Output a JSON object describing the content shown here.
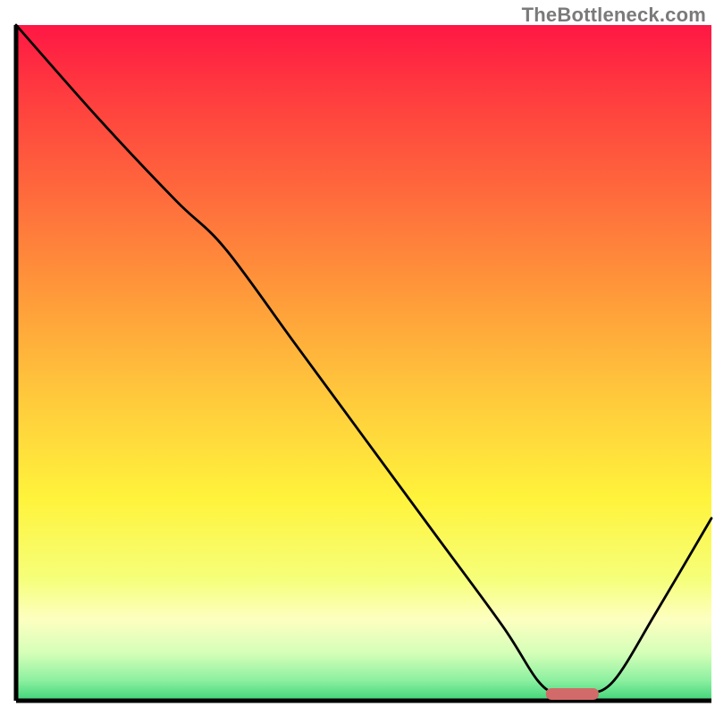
{
  "watermark": "TheBottleneck.com",
  "chart_data": {
    "type": "line",
    "title": "",
    "xlabel": "",
    "ylabel": "",
    "xlim": [
      0,
      100
    ],
    "ylim": [
      0,
      100
    ],
    "grid": false,
    "legend": false,
    "series": [
      {
        "name": "bottleneck-curve",
        "x": [
          0,
          12,
          23,
          30,
          40,
          50,
          60,
          70,
          75,
          78,
          82,
          86,
          92,
          100
        ],
        "y": [
          100,
          86,
          74,
          67,
          53,
          39,
          25,
          11,
          3,
          1,
          1,
          3,
          13,
          27
        ]
      }
    ],
    "marker": {
      "name": "optimal-range",
      "x_center": 80,
      "x_half_width": 3.8,
      "y": 1,
      "color": "#d36a6a"
    },
    "background_gradient": {
      "type": "vertical",
      "stops": [
        {
          "offset": 0.0,
          "color": "#ff1744"
        },
        {
          "offset": 0.1,
          "color": "#ff3b3f"
        },
        {
          "offset": 0.25,
          "color": "#ff6a3c"
        },
        {
          "offset": 0.4,
          "color": "#ff9a3a"
        },
        {
          "offset": 0.55,
          "color": "#ffc93c"
        },
        {
          "offset": 0.7,
          "color": "#fff33b"
        },
        {
          "offset": 0.82,
          "color": "#f6ff7a"
        },
        {
          "offset": 0.88,
          "color": "#fdffc0"
        },
        {
          "offset": 0.93,
          "color": "#d4ffb8"
        },
        {
          "offset": 0.97,
          "color": "#8cf0a0"
        },
        {
          "offset": 1.0,
          "color": "#3ed478"
        }
      ]
    },
    "axes_color": "#000000",
    "line_color": "#000000",
    "line_width": 2.8
  }
}
